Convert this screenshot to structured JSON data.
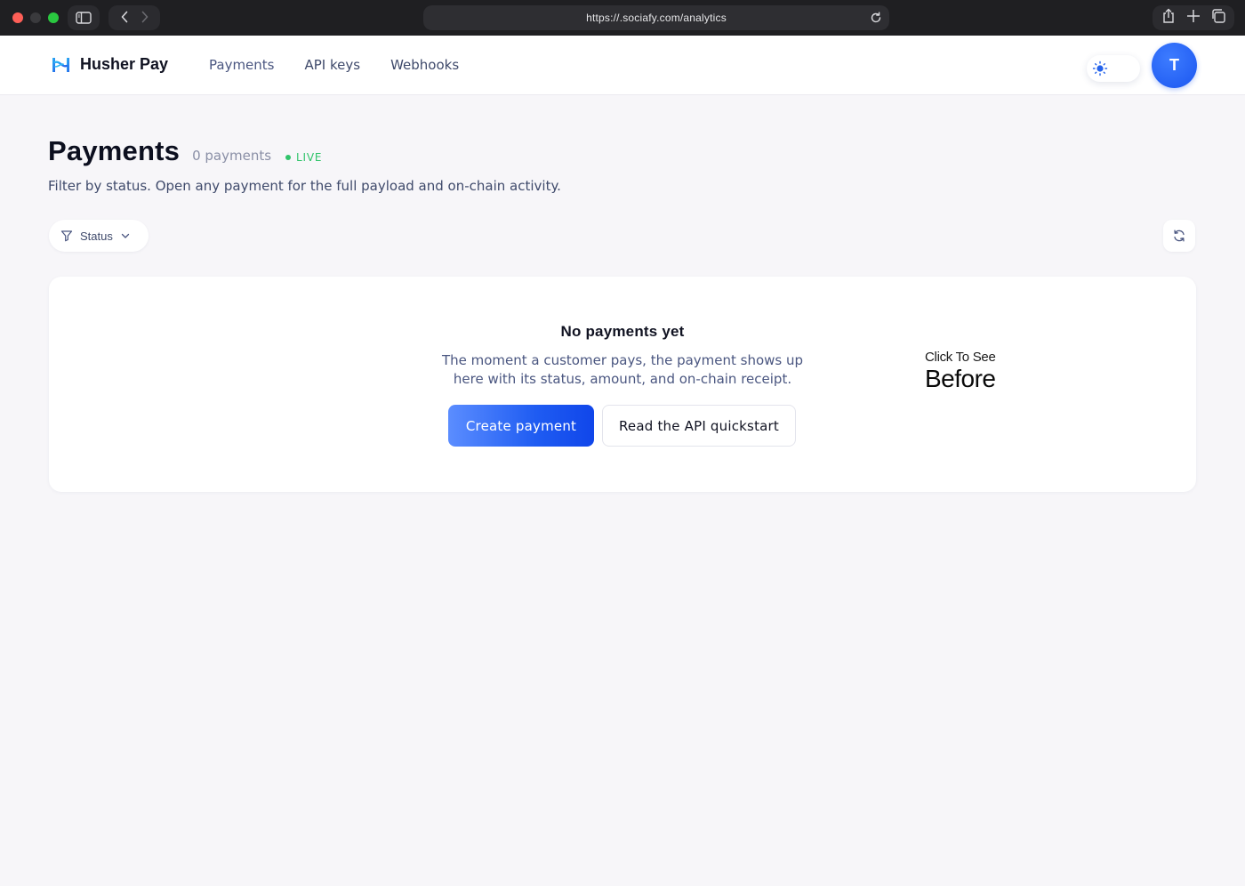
{
  "browser": {
    "url": "https://.sociafy.com/analytics"
  },
  "header": {
    "brand": "Husher Pay",
    "nav": [
      {
        "label": "Payments",
        "active": true
      },
      {
        "label": "API keys",
        "active": false
      },
      {
        "label": "Webhooks",
        "active": false
      }
    ],
    "avatar_initial": "T",
    "theme_icon": "sun-icon"
  },
  "page": {
    "title": "Payments",
    "count": "0 payments",
    "live_badge": "LIVE",
    "subtitle": "Filter by status. Open any payment for the full payload and on-chain activity."
  },
  "filters": {
    "status_label": "Status"
  },
  "empty_state": {
    "title": "No payments yet",
    "description_line1": "The moment a customer pays, the payment shows up",
    "description_line2": "here with its status, amount, and on-chain receipt.",
    "primary_button": "Create payment",
    "secondary_button": "Read the API quickstart"
  },
  "overlay": {
    "small": "Click To See",
    "big": "Before"
  },
  "colors": {
    "accent": "#1f5cf2",
    "live": "#31c46b",
    "background": "#f7f6f9"
  }
}
